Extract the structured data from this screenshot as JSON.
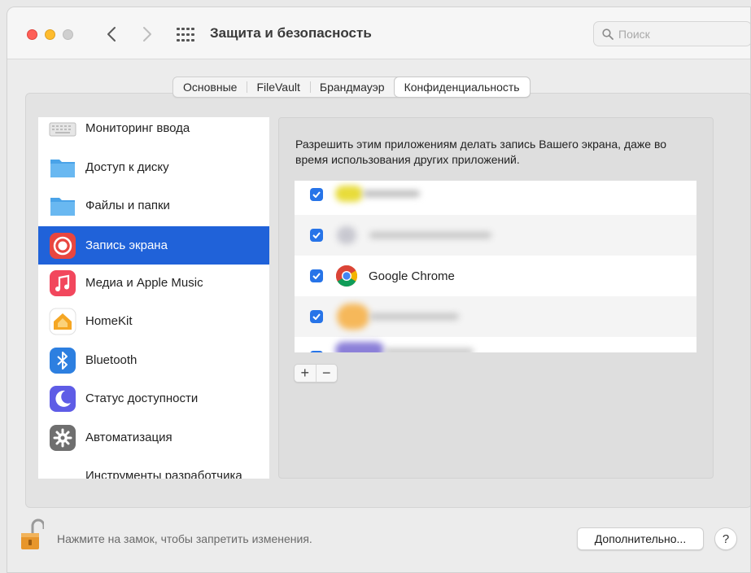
{
  "window": {
    "title": "Защита и безопасность"
  },
  "search": {
    "placeholder": "Поиск"
  },
  "tabs": [
    {
      "label": "Основные"
    },
    {
      "label": "FileVault"
    },
    {
      "label": "Брандмауэр"
    },
    {
      "label": "Конфиденциальность",
      "active": true
    }
  ],
  "sidebar": {
    "items": [
      {
        "label": "Мониторинг ввода",
        "icon": "keyboard-icon"
      },
      {
        "label": "Доступ к диску",
        "icon": "folder-icon"
      },
      {
        "label": "Файлы и папки",
        "icon": "folder-icon"
      },
      {
        "label": "Запись экрана",
        "icon": "screen-record-icon",
        "selected": true
      },
      {
        "label": "Медиа и Apple Music",
        "icon": "music-icon"
      },
      {
        "label": "HomeKit",
        "icon": "home-icon"
      },
      {
        "label": "Bluetooth",
        "icon": "bluetooth-icon"
      },
      {
        "label": "Статус доступности",
        "icon": "moon-icon"
      },
      {
        "label": "Автоматизация",
        "icon": "gear-icon"
      },
      {
        "label": "Инструменты разработчика",
        "icon": "developer-tools-icon"
      }
    ]
  },
  "main": {
    "description": "Разрешить этим приложениям делать запись Вашего экрана, даже во время использования других приложений.",
    "apps": [
      {
        "name": "",
        "checked": true,
        "blurred": true
      },
      {
        "name": "",
        "checked": true,
        "blurred": true
      },
      {
        "name": "Google Chrome",
        "checked": true,
        "icon": "chrome-icon"
      },
      {
        "name": "",
        "checked": true,
        "blurred": true
      },
      {
        "name": "",
        "checked": true,
        "blurred": true
      }
    ],
    "add_label": "+",
    "remove_label": "−"
  },
  "footer": {
    "lock_text": "Нажмите на замок, чтобы запретить изменения.",
    "advanced_label": "Дополнительно...",
    "help_label": "?"
  },
  "colors": {
    "accent": "#2062d9",
    "checkbox": "#2774e8",
    "traffic_red": "#fe5f57",
    "traffic_yellow": "#febc2e"
  }
}
